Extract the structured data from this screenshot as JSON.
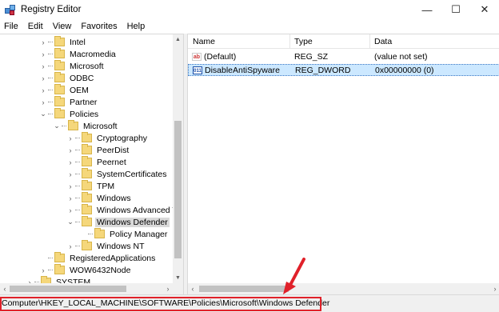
{
  "window": {
    "title": "Registry Editor",
    "minimize": "—",
    "maximize": "☐",
    "close": "✕"
  },
  "menu": [
    "File",
    "Edit",
    "View",
    "Favorites",
    "Help"
  ],
  "tree": {
    "items": [
      {
        "label": "Intel",
        "level": 3,
        "expander": "›",
        "selected": false
      },
      {
        "label": "Macromedia",
        "level": 3,
        "expander": "›",
        "selected": false
      },
      {
        "label": "Microsoft",
        "level": 3,
        "expander": "›",
        "selected": false
      },
      {
        "label": "ODBC",
        "level": 3,
        "expander": "›",
        "selected": false
      },
      {
        "label": "OEM",
        "level": 3,
        "expander": "›",
        "selected": false
      },
      {
        "label": "Partner",
        "level": 3,
        "expander": "›",
        "selected": false
      },
      {
        "label": "Policies",
        "level": 3,
        "expander": "⌄",
        "selected": false
      },
      {
        "label": "Microsoft",
        "level": 4,
        "expander": "⌄",
        "selected": false
      },
      {
        "label": "Cryptography",
        "level": 5,
        "expander": "›",
        "selected": false
      },
      {
        "label": "PeerDist",
        "level": 5,
        "expander": "›",
        "selected": false
      },
      {
        "label": "Peernet",
        "level": 5,
        "expander": "›",
        "selected": false
      },
      {
        "label": "SystemCertificates",
        "level": 5,
        "expander": "›",
        "selected": false
      },
      {
        "label": "TPM",
        "level": 5,
        "expander": "›",
        "selected": false
      },
      {
        "label": "Windows",
        "level": 5,
        "expander": "›",
        "selected": false
      },
      {
        "label": "Windows Advanced Th",
        "level": 5,
        "expander": "›",
        "selected": false
      },
      {
        "label": "Windows Defender",
        "level": 5,
        "expander": "⌄",
        "selected": true
      },
      {
        "label": "Policy Manager",
        "level": 6,
        "expander": "",
        "selected": false
      },
      {
        "label": "Windows NT",
        "level": 5,
        "expander": "›",
        "selected": false
      },
      {
        "label": "RegisteredApplications",
        "level": 3,
        "expander": "",
        "selected": false
      },
      {
        "label": "WOW6432Node",
        "level": 3,
        "expander": "›",
        "selected": false
      },
      {
        "label": "SYSTEM",
        "level": 2,
        "expander": "›",
        "selected": false
      }
    ]
  },
  "list": {
    "columns": [
      "Name",
      "Type",
      "Data"
    ],
    "rows": [
      {
        "icon": "string-value-icon",
        "icon_text": "ab",
        "name": "(Default)",
        "type": "REG_SZ",
        "data": "(value not set)",
        "selected": false
      },
      {
        "icon": "dword-value-icon",
        "icon_text": "011",
        "name": "DisableAntiSpyware",
        "type": "REG_DWORD",
        "data": "0x00000000 (0)",
        "selected": true
      }
    ]
  },
  "status": {
    "path": "Computer\\HKEY_LOCAL_MACHINE\\SOFTWARE\\Policies\\Microsoft\\Windows Defender"
  },
  "colors": {
    "annotation": "#e0212a",
    "selection": "#cce8ff"
  }
}
